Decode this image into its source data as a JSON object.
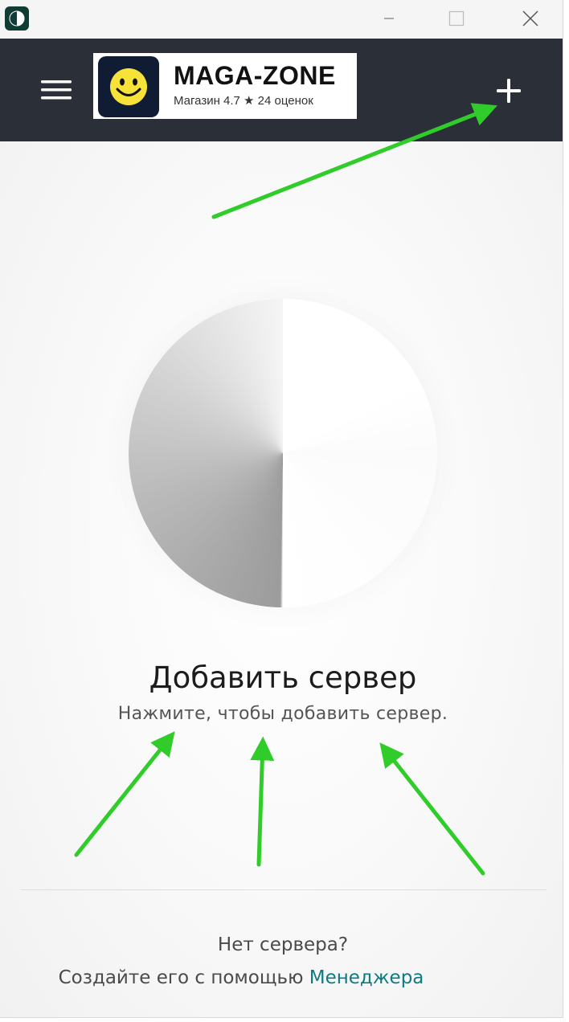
{
  "window": {
    "controls": {
      "minimize_icon": "minimize-icon",
      "maximize_icon": "maximize-icon",
      "close_icon": "close-icon"
    }
  },
  "header": {
    "menu_icon": "hamburger-icon",
    "add_icon": "plus-icon",
    "background": "#2a2f38"
  },
  "watermark": {
    "name": "MAGA-ZONE",
    "rating_text": "Магазин 4.7 ★ 24 оценок",
    "logo_icon": "smiley-icon"
  },
  "empty_state": {
    "title": "Добавить сервер",
    "subtitle": "Нажмите, чтобы добавить сервер."
  },
  "footer": {
    "question": "Нет сервера?",
    "prompt": "Создайте его с помощью ",
    "link_label": "Менеджера",
    "link_color": "#0f7a82"
  },
  "annotations": {
    "arrow_color": "#2fcc2a"
  }
}
